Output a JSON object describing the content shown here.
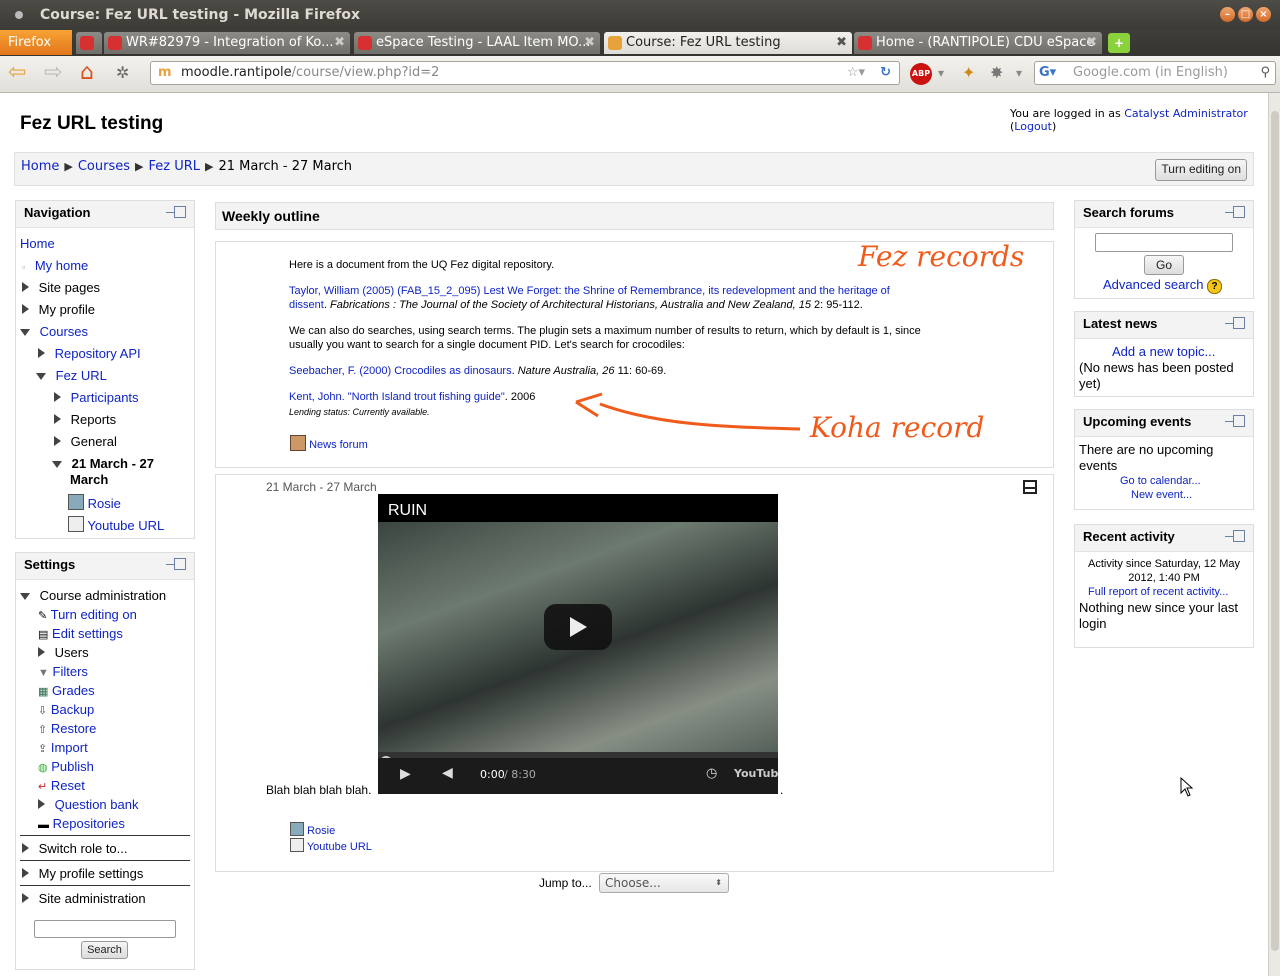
{
  "browser": {
    "window_title": "Course: Fez URL testing - Mozilla Firefox",
    "menu_label": "Firefox",
    "tabs": [
      {
        "label": "WR#82979 - Integration of Ko..."
      },
      {
        "label": "eSpace Testing - LAAL Item MO..."
      },
      {
        "label": "Course: Fez URL testing"
      },
      {
        "label": "Home - (RANTIPOLE) CDU eSpace"
      }
    ],
    "url_host": "moodle.rantipole",
    "url_path": "/course/view.php?id=2",
    "search_placeholder": "Google.com (in English)",
    "abp_label": "ABP"
  },
  "page": {
    "title": "Fez URL testing",
    "login_prefix": "You are logged in as ",
    "login_user": "Catalyst Administrator",
    "login_open": " (",
    "logout": "Logout",
    "login_close": ")",
    "breadcrumb": [
      "Home",
      "Courses",
      "Fez URL",
      "21 March - 27 March"
    ],
    "breadcrumb_sep": "▶",
    "edit_button": "Turn editing on"
  },
  "navigation": {
    "title": "Navigation",
    "items": {
      "home": "Home",
      "my_home": "My home",
      "site_pages": "Site pages",
      "my_profile": "My profile",
      "courses": "Courses",
      "repository_api": "Repository API",
      "fez_url": "Fez URL",
      "participants": "Participants",
      "reports": "Reports",
      "general": "General",
      "week_line1": "21 March - 27",
      "week_line2": "March",
      "rosie": "Rosie",
      "youtube_url": "Youtube URL"
    }
  },
  "settings": {
    "title": "Settings",
    "course_admin": "Course administration",
    "items": [
      "Turn editing on",
      "Edit settings",
      "Users",
      "Filters",
      "Grades",
      "Backup",
      "Restore",
      "Import",
      "Publish",
      "Reset",
      "Question bank",
      "Repositories"
    ],
    "switch_role": "Switch role to...",
    "my_profile_settings": "My profile settings",
    "site_admin": "Site administration",
    "search_button": "Search"
  },
  "main": {
    "outline_title": "Weekly outline",
    "intro": "Here is a document from the UQ Fez digital repository.",
    "record1_author": "Taylor, William",
    "record1_year": "(2005)",
    "record1_title_line1": "(FAB_15_2_095) Lest We Forget: the Shrine of Remembrance, its redevelopment and the heritage of",
    "record1_title_line2": "dissent",
    "record1_journal": "Fabrications : The Journal of the Society of Architectural Historians, Australia and New Zealand, 15",
    "record1_pages": " 2: 95-112.",
    "search_text_line1": "We can also do searches, using search terms. The plugin sets a maximum number of results to return, which by default is 1, since",
    "search_text_line2": "usually you want to search for a single document PID. Let's search for crocodiles:",
    "record2_author": "Seebacher, F.",
    "record2_year": "(2000)",
    "record2_title": "Crocodiles as dinosaurs",
    "record2_journal": "Nature Australia, 26",
    "record2_pages": " 11: 60-69.",
    "koha_author": "Kent, John.",
    "koha_title": "\"North Island trout fishing guide\"",
    "koha_year": ". 2006",
    "koha_status": "Lending status: Currently available.",
    "news_forum": "News forum",
    "annotation_fez": "Fez records",
    "annotation_koha": "Koha record",
    "week_title": "21 March - 27 March",
    "video_title": "RUIN",
    "video_time_current": "0:00",
    "video_time_total": " / 8:30",
    "video_brand": "YouTube",
    "blah": "Blah blah blah blah.",
    "res_rosie": "Rosie",
    "res_youtube": "Youtube URL",
    "jump_label": "Jump to...",
    "jump_value": "Choose..."
  },
  "right": {
    "search_forums": "Search forums",
    "go": "Go",
    "advanced_search": "Advanced search",
    "latest_news": "Latest news",
    "add_topic": "Add a new topic...",
    "no_news": "(No news has been posted yet)",
    "upcoming_events": "Upcoming events",
    "no_events": "There are no upcoming events",
    "go_calendar": "Go to calendar...",
    "new_event": "New event...",
    "recent_activity": "Recent activity",
    "activity_since": "Activity since Saturday, 12 May 2012, 1:40 PM",
    "full_report": "Full report of recent activity...",
    "nothing_new": "Nothing new since your last login"
  },
  "colors": {
    "link": "#0f24c4",
    "annotation": "#f05a1a"
  }
}
